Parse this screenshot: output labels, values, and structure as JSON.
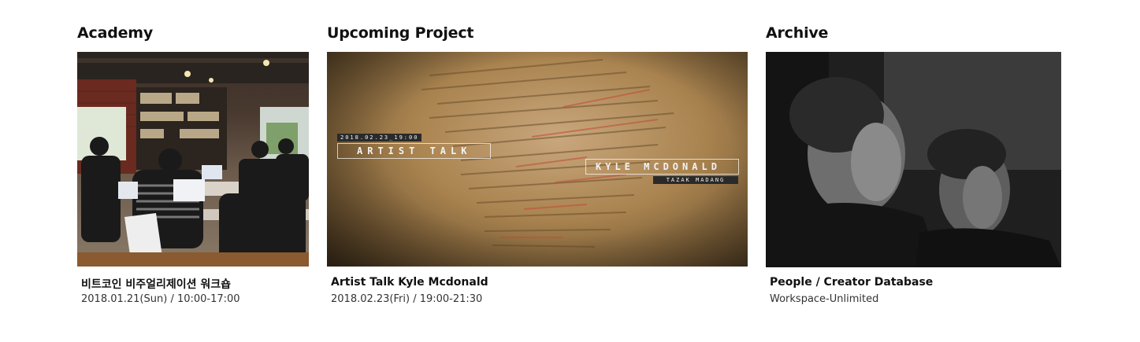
{
  "sections": {
    "academy": {
      "heading": "Academy",
      "card_title": "비트코인 비주얼리제이션 워크숍",
      "card_meta": "2018.01.21(Sun) / 10:00-17:00"
    },
    "upcoming": {
      "heading": "Upcoming Project",
      "card_title": "Artist Talk Kyle Mcdonald",
      "card_meta": "2018.02.23(Fri) / 19:00-21:30",
      "overlay": {
        "date": "2018.02.23_19:00",
        "event": "ARTIST TALK",
        "artist": "KYLE MCDONALD",
        "venue": "TAZAK MADANG"
      }
    },
    "archive": {
      "heading": "Archive",
      "card_title": "People / Creator Database",
      "card_meta": "Workspace-Unlimited"
    }
  }
}
